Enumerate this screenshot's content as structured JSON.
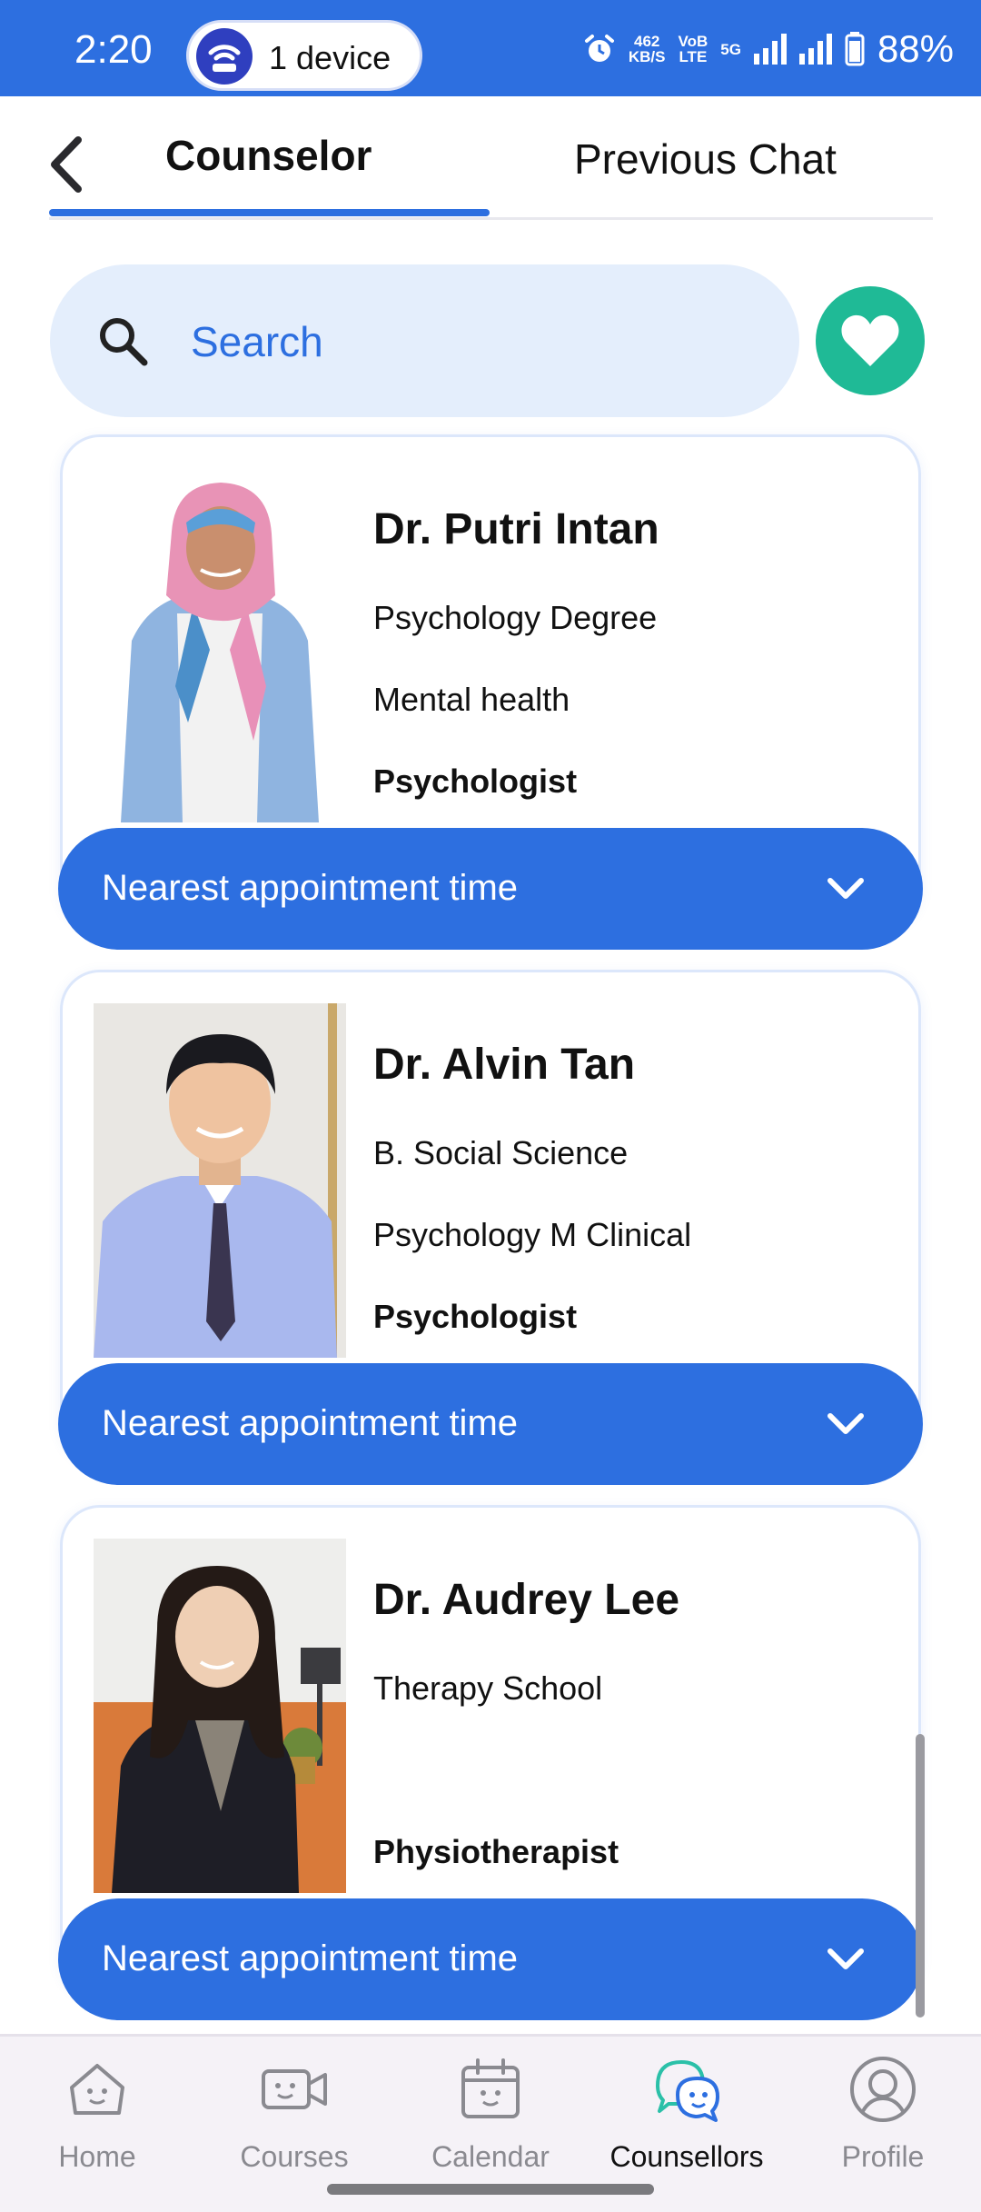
{
  "status_bar": {
    "time": "2:20",
    "device_pill": "1 device",
    "net_speed_value": "462",
    "net_speed_unit": "KB/S",
    "volte_top": "VoB",
    "volte_bottom": "LTE",
    "network": "5G",
    "battery": "88%"
  },
  "header": {
    "tabs": [
      {
        "label": "Counselor",
        "active": true
      },
      {
        "label": "Previous Chat",
        "active": false
      }
    ]
  },
  "search": {
    "placeholder": "Search"
  },
  "counselors": [
    {
      "name": "Dr. Putri Intan",
      "line1": "Psychology Degree",
      "line2": "Mental health",
      "role": "Psychologist",
      "appointment_label": "Nearest appointment time"
    },
    {
      "name": "Dr. Alvin Tan",
      "line1": "B. Social Science",
      "line2": "Psychology M Clinical",
      "role": "Psychologist",
      "appointment_label": "Nearest appointment time"
    },
    {
      "name": "Dr. Audrey Lee",
      "line1": "Therapy School",
      "line2": "",
      "role": "Physiotherapist",
      "appointment_label": "Nearest appointment time"
    }
  ],
  "bottom_nav": [
    {
      "label": "Home",
      "icon": "home-icon",
      "active": false
    },
    {
      "label": "Courses",
      "icon": "video-camera-icon",
      "active": false
    },
    {
      "label": "Calendar",
      "icon": "calendar-icon",
      "active": false
    },
    {
      "label": "Counsellors",
      "icon": "chat-bubbles-icon",
      "active": true
    },
    {
      "label": "Profile",
      "icon": "profile-icon",
      "active": false
    }
  ],
  "colors": {
    "primary": "#2d6fe0",
    "favorite": "#1fba96",
    "search_bg": "#e4eefc",
    "active_nav_icon": "#2bc0a8"
  }
}
